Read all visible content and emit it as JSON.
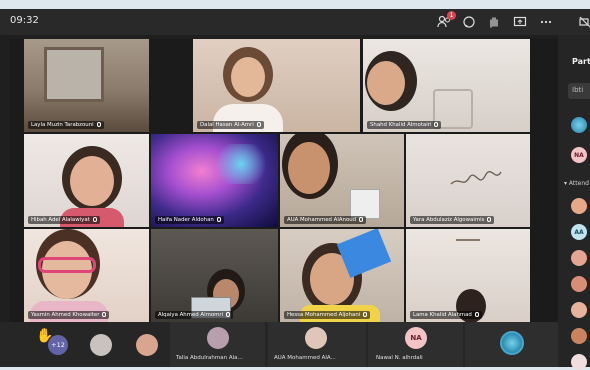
{
  "meeting": {
    "time": "09:32",
    "participants_badge": "1",
    "raised_hand_count": "+12"
  },
  "participants": [
    {
      "name": "Layla Muzin Tarabzouni"
    },
    {
      "name": "Dalal Hasan Al-Amri"
    },
    {
      "name": "Shahd Khalid Almotairi"
    },
    {
      "name": "Hibah Adel Alalawiyat"
    },
    {
      "name": "Haifa Nader Aldohan"
    },
    {
      "name": "AUA Mohammed AlAnoud"
    },
    {
      "name": "Yara Abdulaziz Algowaimis"
    },
    {
      "name": "Yasmin Ahmed Khowaiter"
    },
    {
      "name": "Alqaiya Ahmed Almomri"
    },
    {
      "name": "Hessa Mohammed Aljohani"
    },
    {
      "name": "Lama Khalid Alahmad"
    }
  ],
  "strip": [
    {
      "name": "Talia Abdulrahman Ala..."
    },
    {
      "name": "AUA Mohammed AlA..."
    },
    {
      "name": "Nawal N. alhrdali",
      "initials": "NA"
    }
  ],
  "sidebar": {
    "title": "Part",
    "search": "Ibti",
    "section": "Attend",
    "avatar_initials": [
      "NA",
      "AA"
    ]
  },
  "colors": {
    "accent": "#6264a7",
    "badge": "#d74654"
  }
}
